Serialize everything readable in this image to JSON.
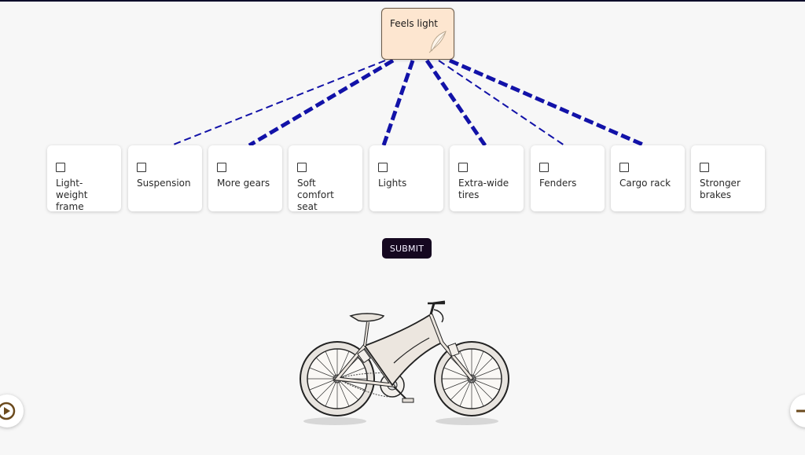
{
  "target": {
    "label": "Feels light",
    "icon": "feather-icon"
  },
  "options": [
    {
      "label": "Light-weight frame",
      "checked": false
    },
    {
      "label": "Suspension",
      "checked": false
    },
    {
      "label": "More gears",
      "checked": false
    },
    {
      "label": "Soft comfort seat",
      "checked": false
    },
    {
      "label": "Lights",
      "checked": false
    },
    {
      "label": "Extra-wide tires",
      "checked": false
    },
    {
      "label": "Fenders",
      "checked": false
    },
    {
      "label": "Cargo rack",
      "checked": false
    },
    {
      "label": "Stronger brakes",
      "checked": false
    }
  ],
  "links": [
    {
      "option": "Light-weight frame",
      "strength": "thin"
    },
    {
      "option": "More gears",
      "strength": "thick"
    },
    {
      "option": "Lights",
      "strength": "thick"
    },
    {
      "option": "Extra-wide tires",
      "strength": "thick"
    },
    {
      "option": "Fenders",
      "strength": "thin"
    },
    {
      "option": "Cargo rack",
      "strength": "thick"
    }
  ],
  "submit": {
    "label": "SUBMIT"
  },
  "illustration": {
    "icon": "bicycle-icon"
  },
  "nav": {
    "left_icon": "replay-icon",
    "right_icon": "next-icon"
  },
  "colors": {
    "line": "#1212a8",
    "target_bg": "#fde6d0",
    "submit_bg": "#150820"
  }
}
